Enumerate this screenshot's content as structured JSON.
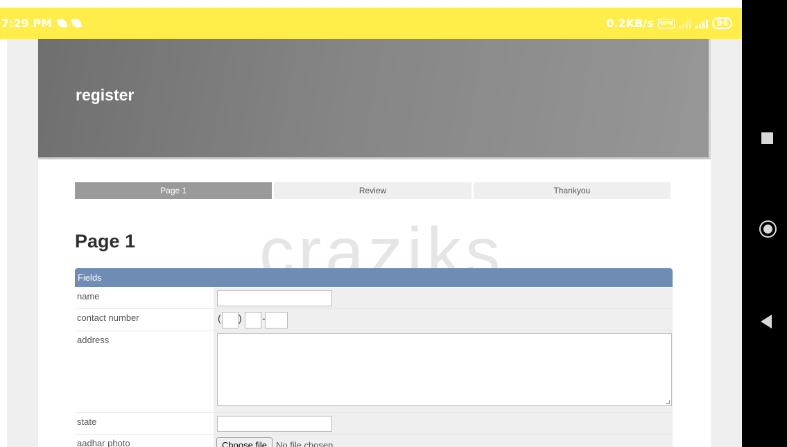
{
  "status_bar": {
    "time": "7:29 PM",
    "net_speed": "0.2KB/s",
    "vpn_label": "VPN",
    "battery": "94"
  },
  "hero": {
    "title": "register"
  },
  "steps": [
    {
      "label": "Page 1",
      "active": true
    },
    {
      "label": "Review",
      "active": false
    },
    {
      "label": "Thankyou",
      "active": false
    }
  ],
  "watermark": "craziks",
  "page_heading": "Page 1",
  "fields_header": "Fields",
  "form": {
    "name": {
      "label": "name",
      "value": ""
    },
    "contact": {
      "label": "contact number",
      "open_paren": "(",
      "close_paren": ")",
      "dash": "-"
    },
    "address": {
      "label": "address",
      "value": ""
    },
    "state": {
      "label": "state",
      "value": ""
    },
    "aadhar": {
      "label": "aadhar photo",
      "button": "Choose file",
      "status": "No file chosen"
    }
  },
  "colors": {
    "status_bar": "#ffee4a",
    "fields_header": "#6f8cb4",
    "active_step": "#9a9a9a"
  }
}
